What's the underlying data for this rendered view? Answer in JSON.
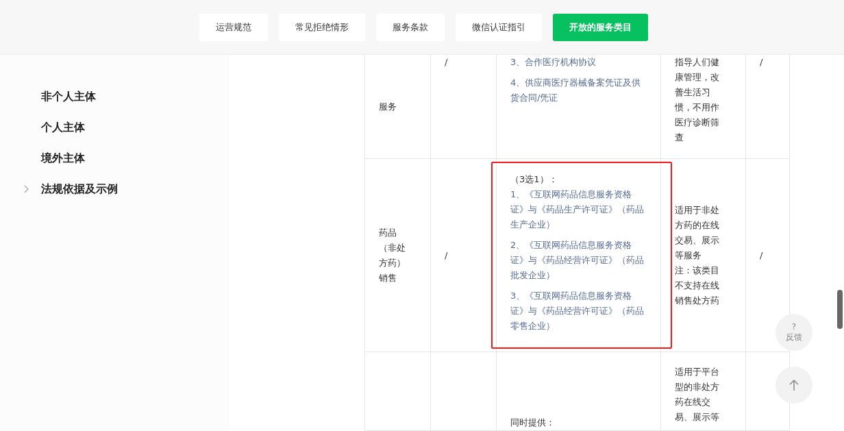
{
  "nav": [
    {
      "label": "运营规范",
      "selected": false
    },
    {
      "label": "常见拒绝情形",
      "selected": false
    },
    {
      "label": "服务条款",
      "selected": false
    },
    {
      "label": "微信认证指引",
      "selected": false
    },
    {
      "label": "开放的服务类目",
      "selected": true
    }
  ],
  "sidebar": {
    "items": [
      {
        "label": "非个人主体",
        "expandable": false
      },
      {
        "label": "个人主体",
        "expandable": false
      },
      {
        "label": "境外主体",
        "expandable": false
      },
      {
        "label": "法规依据及示例",
        "expandable": true
      }
    ]
  },
  "table": {
    "rows": [
      {
        "highlighted": false,
        "category": "服务",
        "column_2": "/",
        "requirements": [
          {
            "kind": "link",
            "text": "3、合作医疗机构协议"
          },
          {
            "kind": "link",
            "text": "4、供应商医疗器械备案凭证及供货合同/凭证"
          }
        ],
        "scope": [
          "指导人们健康管理，改善生活习惯，不用作医疗诊断筛查"
        ],
        "column_5": "/"
      },
      {
        "highlighted": true,
        "category": "药品（非处方药）销售",
        "column_2": "/",
        "requirements": [
          {
            "kind": "plain",
            "text": "（3选1）："
          },
          {
            "kind": "link",
            "text": "1、《互联网药品信息服务资格证》与《药品生产许可证》（药品生产企业）"
          },
          {
            "kind": "link",
            "text": "2、《互联网药品信息服务资格证》与《药品经营许可证》（药品批发企业）"
          },
          {
            "kind": "link",
            "text": "3、《互联网药品信息服务资格证》与《药品经营许可证》（药品零售企业）"
          }
        ],
        "scope": [
          "适用于非处方药的在线交易、展示等服务",
          "注：该类目不支持在线销售处方药"
        ],
        "column_5": "/"
      },
      {
        "highlighted": false,
        "requirements": [
          {
            "kind": "plain",
            "text": "同时提供："
          }
        ],
        "scope": [
          "适用于平台型的非处方药在线交易、展示等"
        ]
      }
    ]
  },
  "feedback": {
    "mark": "?",
    "label": "反馈"
  }
}
